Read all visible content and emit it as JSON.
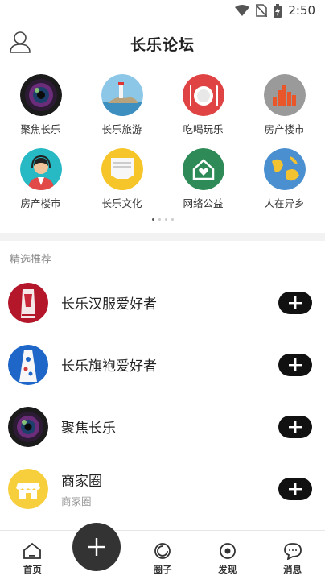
{
  "status": {
    "time": "2:50"
  },
  "header": {
    "title": "长乐论坛"
  },
  "categories": [
    {
      "label": "聚焦长乐",
      "icon": "camera-lens-icon"
    },
    {
      "label": "长乐旅游",
      "icon": "lighthouse-icon"
    },
    {
      "label": "吃喝玩乐",
      "icon": "dining-plate-icon"
    },
    {
      "label": "房产楼市",
      "icon": "buildings-icon"
    },
    {
      "label": "房产楼市",
      "icon": "headset-agent-icon"
    },
    {
      "label": "长乐文化",
      "icon": "envelope-icon"
    },
    {
      "label": "网络公益",
      "icon": "charity-house-icon"
    },
    {
      "label": "人在异乡",
      "icon": "globe-icon"
    }
  ],
  "section": {
    "title": "精选推荐"
  },
  "recommendations": [
    {
      "name": "长乐汉服爱好者",
      "sub": "",
      "avatar": "hanfu-avatar"
    },
    {
      "name": "长乐旗袍爱好者",
      "sub": "",
      "avatar": "qipao-avatar"
    },
    {
      "name": "聚焦长乐",
      "sub": "",
      "avatar": "camera-lens-avatar"
    },
    {
      "name": "商家圈",
      "sub": "商家圈",
      "avatar": "shop-avatar"
    }
  ],
  "tabbar": {
    "home": "首页",
    "circle": "圈子",
    "discover": "发现",
    "messages": "消息"
  },
  "colors": {
    "accent": "#111111",
    "separator": "#f2f2f2"
  }
}
